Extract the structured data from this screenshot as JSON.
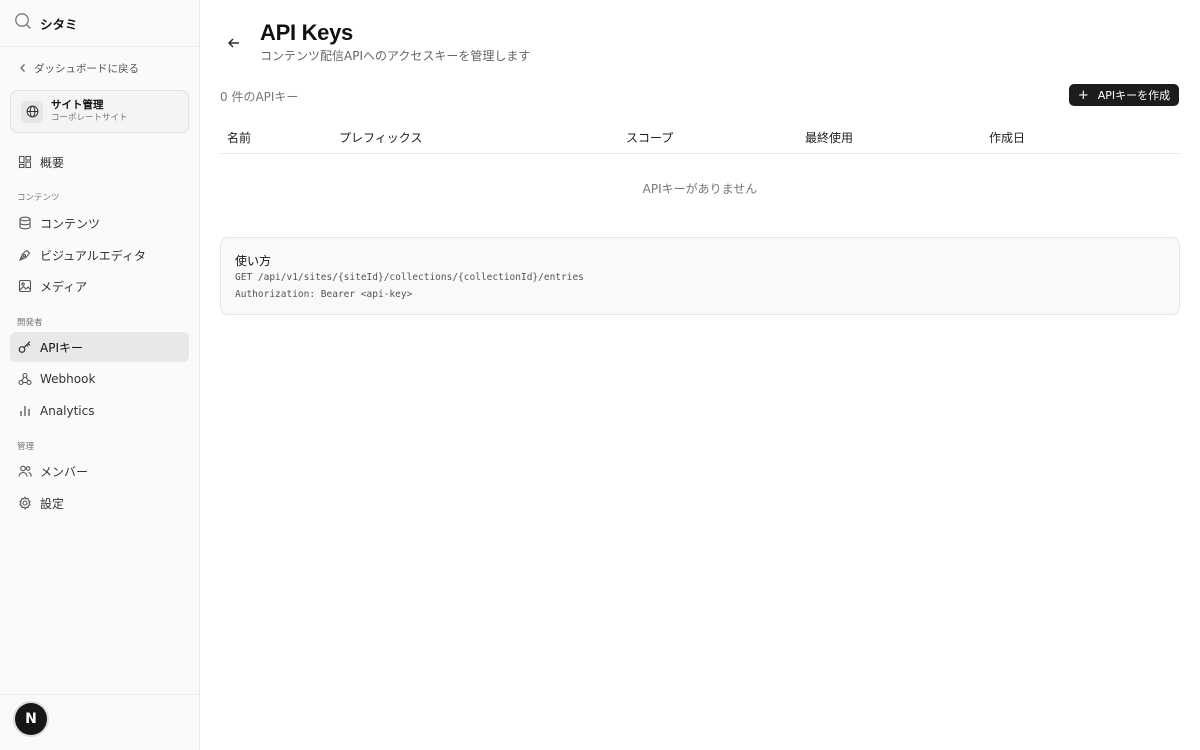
{
  "app": {
    "name": "シタミ"
  },
  "sidebar": {
    "back_label": "ダッシュボードに戻る",
    "site": {
      "title": "サイト管理",
      "subtitle": "コーポレートサイト"
    },
    "overview_label": "概要",
    "sections": {
      "content": "コンテンツ",
      "developer": "開発者",
      "admin": "管理"
    },
    "items": {
      "contents": "コンテンツ",
      "visual_editor": "ビジュアルエディタ",
      "media": "メディア",
      "api_keys": "APIキー",
      "webhook": "Webhook",
      "analytics": "Analytics",
      "members": "メンバー",
      "settings": "設定"
    },
    "avatar_initial": "N"
  },
  "header": {
    "title": "API Keys",
    "subtitle": "コンテンツ配信APIへのアクセスキーを管理します"
  },
  "toolbar": {
    "count_text": "0 件のAPIキー",
    "create_label": "APIキーを作成"
  },
  "table": {
    "columns": [
      "名前",
      "プレフィックス",
      "スコープ",
      "最終使用",
      "作成日"
    ],
    "rows": [],
    "empty_text": "APIキーがありません"
  },
  "usage": {
    "title": "使い方",
    "lines": [
      "GET /api/v1/sites/{siteId}/collections/{collectionId}/entries",
      "Authorization: Bearer <api-key>"
    ]
  },
  "colors": {
    "sidebar_bg": "#fafafa",
    "active_item_bg": "#e8e8e8",
    "primary_button": "#1c1c1c"
  }
}
